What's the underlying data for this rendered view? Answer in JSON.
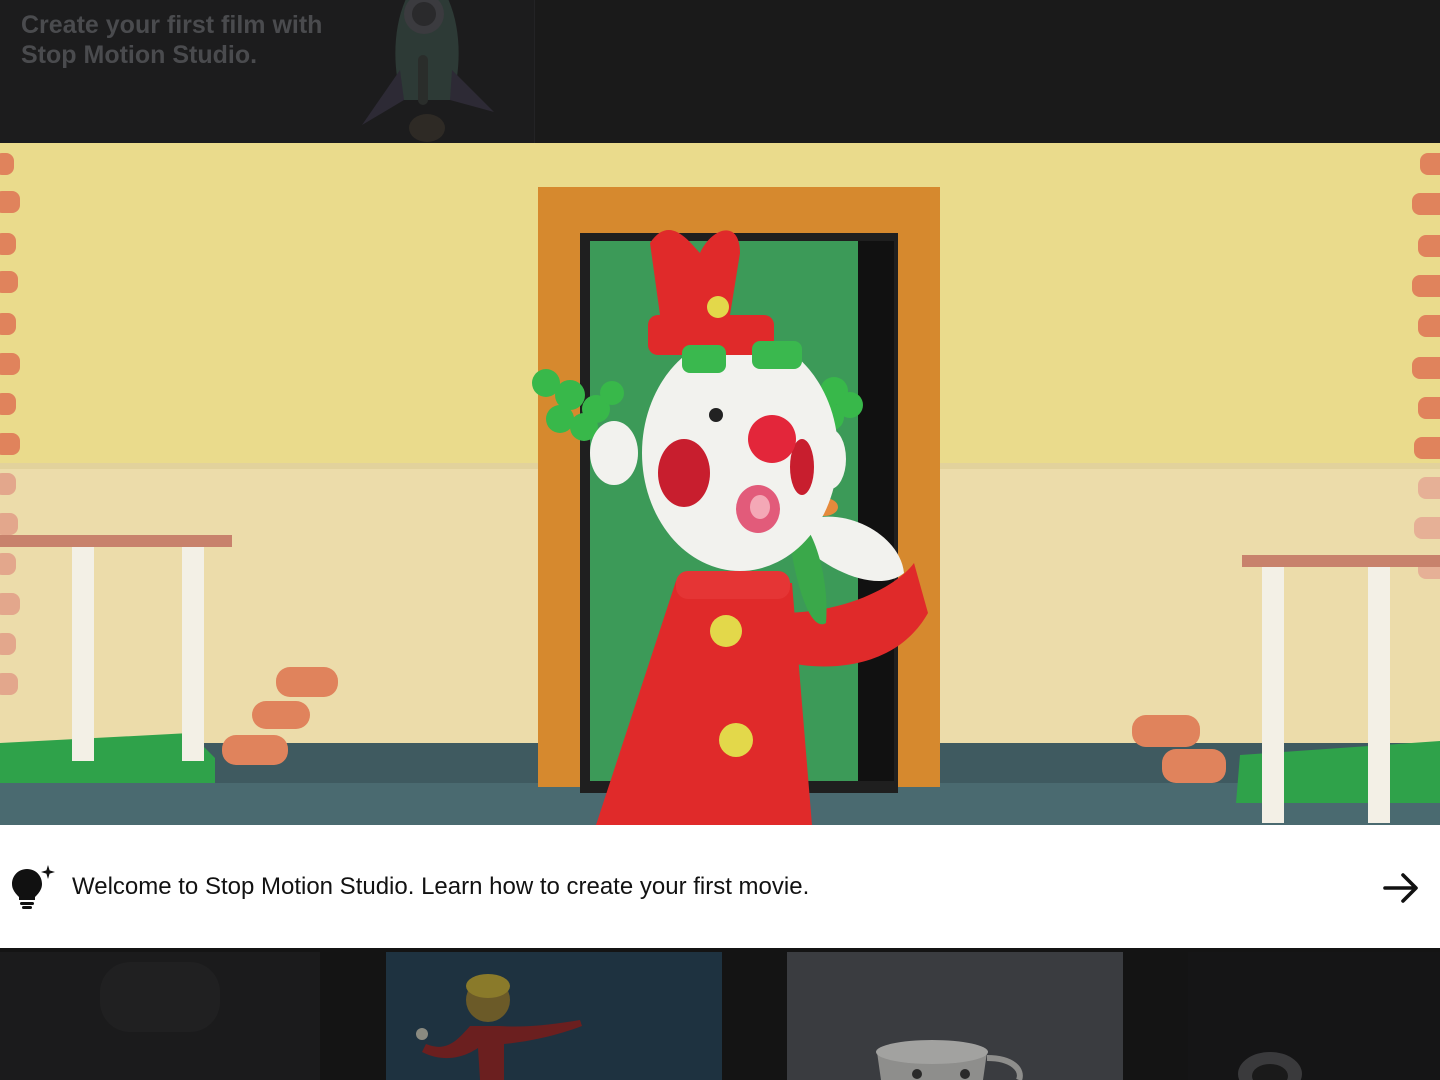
{
  "background": {
    "headline": "Create your first film with Stop Motion Studio."
  },
  "tutorial": {
    "message": "Welcome to Stop Motion Studio. Learn how to create your first movie.",
    "tip_icon": "lightbulb-sparkle-icon",
    "next_icon": "arrow-right-icon"
  },
  "colors": {
    "banner_bg": "#ffffff",
    "dim_bg": "#141414",
    "text": "#121212"
  }
}
